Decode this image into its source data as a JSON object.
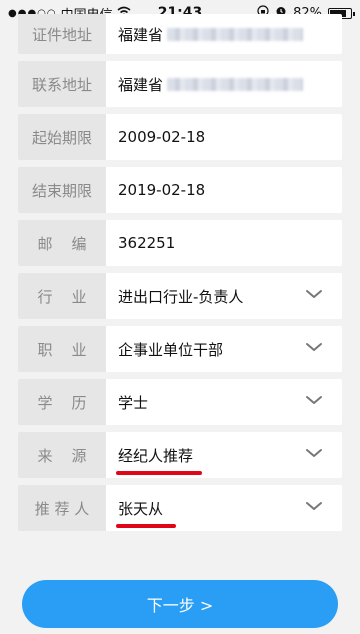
{
  "status_bar": {
    "carrier": "中国电信",
    "signal": "●●●○○",
    "time": "21:43",
    "battery": "82%",
    "battery_level": 0.82
  },
  "form": {
    "rows": [
      {
        "label": "证件地址",
        "value": "福建省"
      },
      {
        "label": "联系地址",
        "value": "福建省"
      },
      {
        "label": "起始期限",
        "value": "2009-02-18"
      },
      {
        "label": "结束期限",
        "value": "2019-02-18"
      },
      {
        "label": "邮    编",
        "value": "362251"
      },
      {
        "label": "行    业",
        "value": "进出口行业-负责人"
      },
      {
        "label": "职    业",
        "value": "企事业单位干部"
      },
      {
        "label": "学    历",
        "value": "学士"
      },
      {
        "label": "来    源",
        "value": "经纪人推荐"
      },
      {
        "label": "推 荐 人",
        "value": "张天从"
      }
    ]
  },
  "next_button": {
    "label": "下一步 >"
  },
  "colors": {
    "accent": "#2a9df4",
    "highlight": "#e0061a"
  }
}
